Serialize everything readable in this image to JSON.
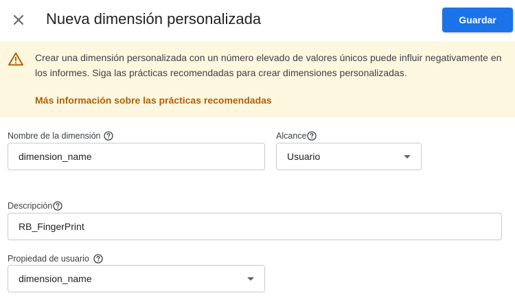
{
  "header": {
    "title": "Nueva dimensión personalizada",
    "save_label": "Guardar"
  },
  "warning": {
    "text": "Crear una dimensión personalizada con un número elevado de valores únicos puede influir negativamente en los informes. Siga las prácticas recomendadas para crear dimensiones personalizadas.",
    "link": "Más información sobre las prácticas recomendadas"
  },
  "form": {
    "dimension_name": {
      "label": "Nombre de la dimensión",
      "value": "dimension_name"
    },
    "scope": {
      "label": "Alcance",
      "value": "Usuario"
    },
    "description": {
      "label": "Descripción",
      "value": "RB_FingerPrint"
    },
    "user_property": {
      "label": "Propiedad de usuario",
      "value": "dimension_name"
    }
  },
  "colors": {
    "accent": "#1a73e8",
    "warning_bg": "#fef7e0",
    "warning_link": "#b06000"
  },
  "icons": [
    "close-icon",
    "warning-icon",
    "help-icon",
    "dropdown-arrow-icon"
  ]
}
